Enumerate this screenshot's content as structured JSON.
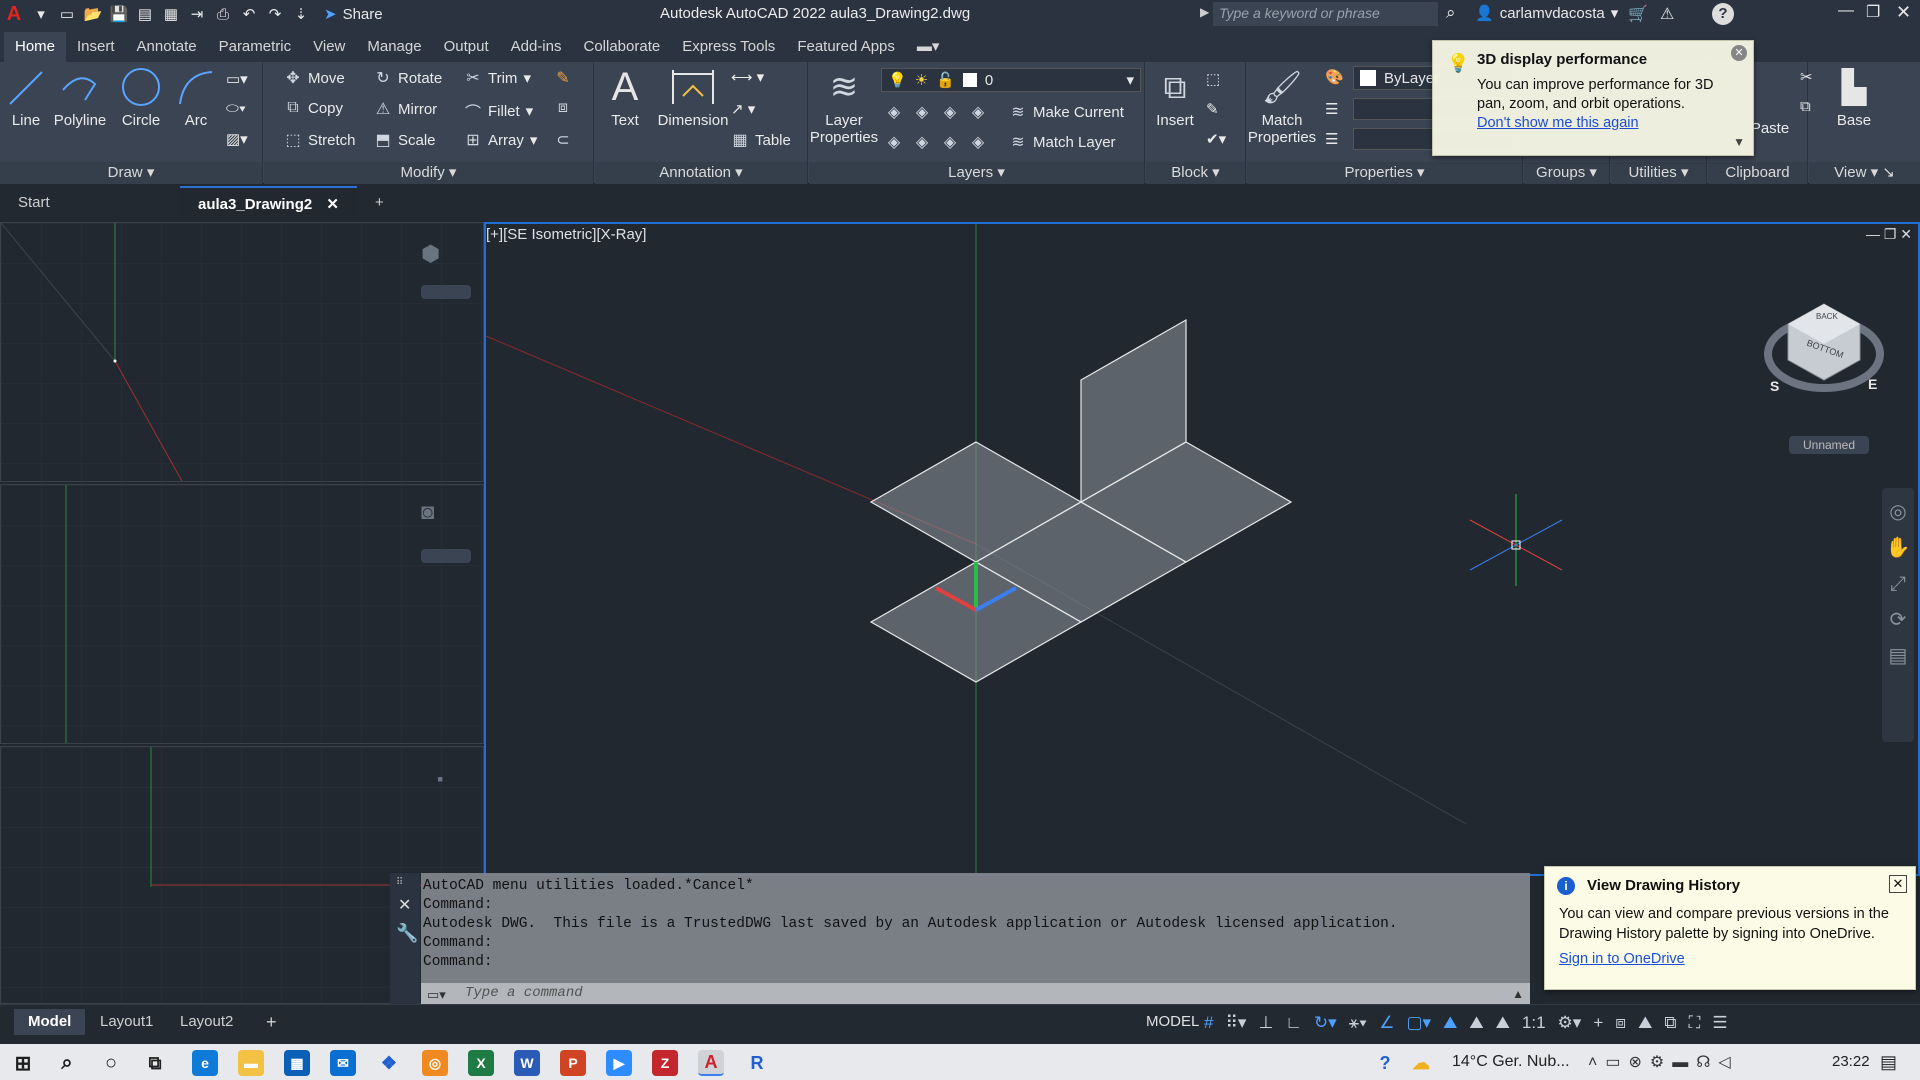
{
  "titlebar": {
    "app_logo": "A",
    "share_label": "Share",
    "title": "Autodesk AutoCAD 2022    aula3_Drawing2.dwg",
    "search_placeholder": "Type a keyword or phrase",
    "username": "carlamvdacosta"
  },
  "ribbon_tabs": [
    "Home",
    "Insert",
    "Annotate",
    "Parametric",
    "View",
    "Manage",
    "Output",
    "Add-ins",
    "Collaborate",
    "Express Tools",
    "Featured Apps"
  ],
  "ribbon": {
    "draw": {
      "title": "Draw",
      "line": "Line",
      "polyline": "Polyline",
      "circle": "Circle",
      "arc": "Arc"
    },
    "modify": {
      "title": "Modify",
      "move": "Move",
      "rotate": "Rotate",
      "trim": "Trim",
      "copy": "Copy",
      "mirror": "Mirror",
      "fillet": "Fillet",
      "stretch": "Stretch",
      "scale": "Scale",
      "array": "Array"
    },
    "annotation": {
      "title": "Annotation",
      "text": "Text",
      "dimension": "Dimension",
      "table": "Table"
    },
    "layers": {
      "title": "Layers",
      "layer_properties_1": "Layer",
      "layer_properties_2": "Properties",
      "current_layer": "0",
      "make_current": "Make Current",
      "match_layer": "Match Layer"
    },
    "block": {
      "title": "Block",
      "insert": "Insert"
    },
    "properties": {
      "title": "Properties",
      "match_1": "Match",
      "match_2": "Properties",
      "bylayer": "ByLayer"
    },
    "groups": {
      "title": "Groups"
    },
    "utilities": {
      "title": "Utilities"
    },
    "clipboard": {
      "title": "Clipboard",
      "paste": "Paste"
    },
    "view": {
      "title": "View",
      "base": "Base"
    }
  },
  "doc_tabs": {
    "start": "Start",
    "drawing": "aula3_Drawing2"
  },
  "viewport": {
    "label": "[+][SE Isometric][X-Ray]",
    "viewcube_label": "Unnamed",
    "cube_face": "BOTTOM",
    "cube_back": "BACK",
    "compass_s": "S",
    "compass_e": "E"
  },
  "command": {
    "history": [
      "AutoCAD menu utilities loaded.*Cancel*",
      "Command:",
      "Autodesk DWG.  This file is a TrustedDWG last saved by an Autodesk application or Autodesk licensed application.",
      "Command:",
      "Command:"
    ],
    "placeholder": "Type a command"
  },
  "layout_tabs": [
    "Model",
    "Layout1",
    "Layout2"
  ],
  "status": {
    "model": "MODEL",
    "scale": "1:1"
  },
  "popup_3d": {
    "title": "3D display performance",
    "body": "You can improve performance for 3D pan, zoom, and orbit operations.",
    "link": "Don't show me this again"
  },
  "popup_history": {
    "title": "View Drawing History",
    "body": "You can view and compare previous versions in the Drawing History palette by signing into OneDrive.",
    "link": "Sign in to OneDrive"
  },
  "taskbar": {
    "weather": "14°C  Ger. Nub...",
    "time": "23:22"
  }
}
